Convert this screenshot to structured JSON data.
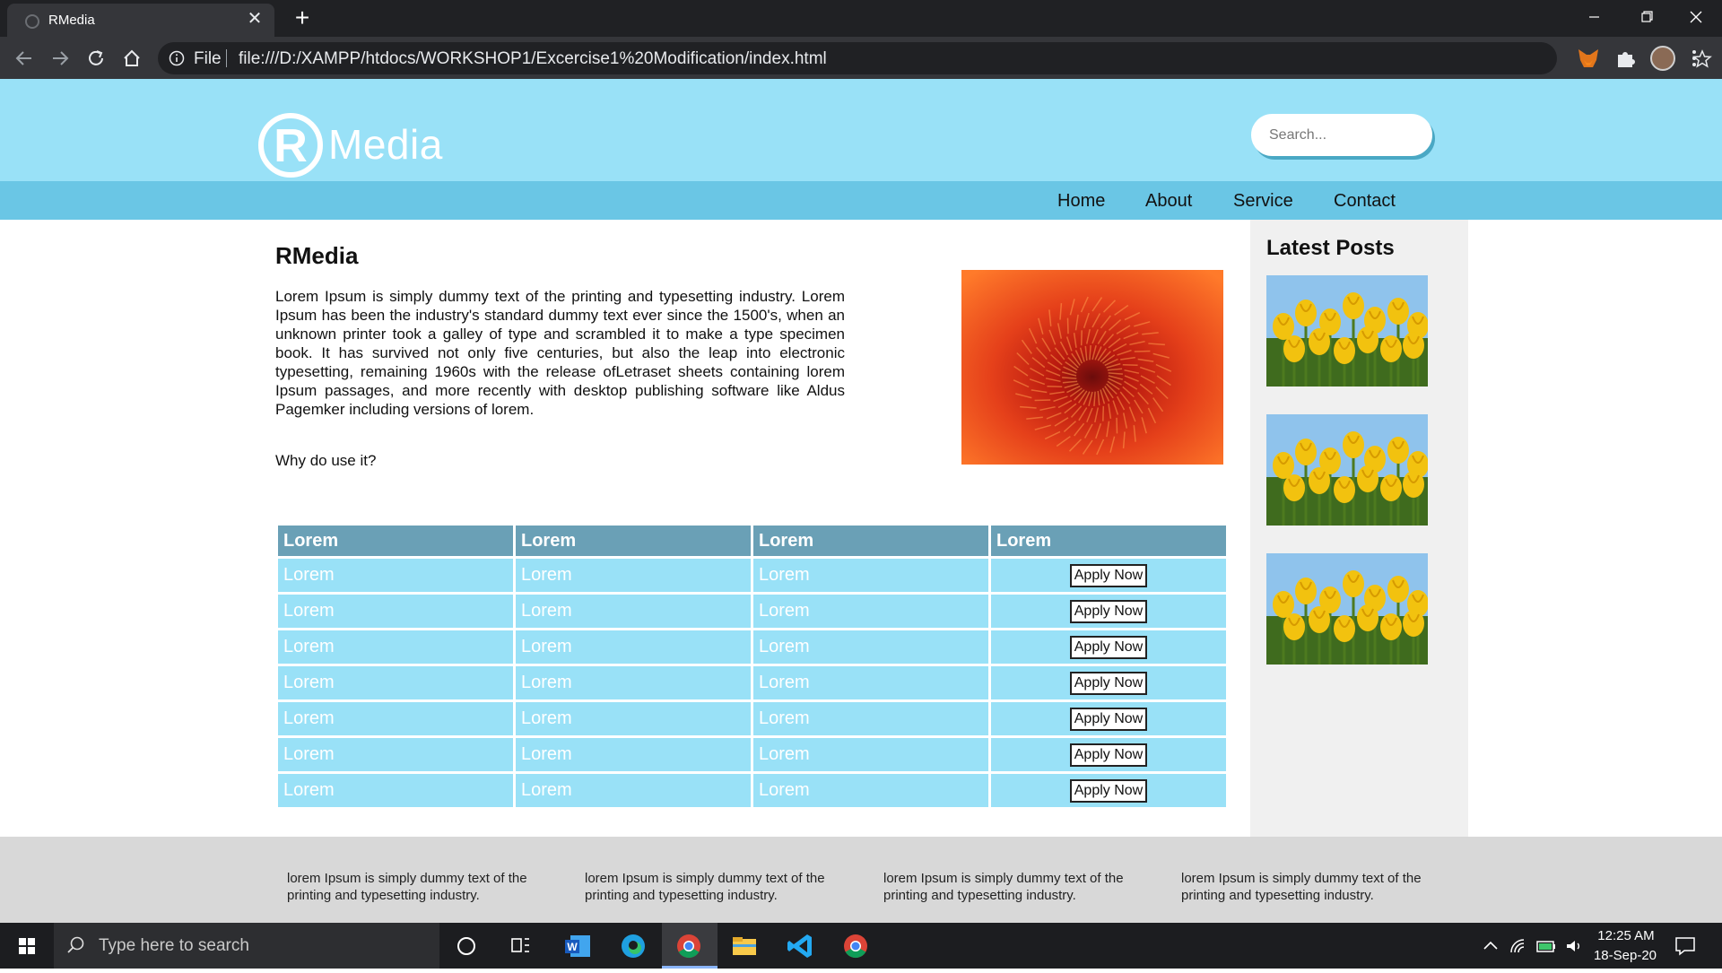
{
  "browser": {
    "tab_title": "RMedia",
    "file_label": "File",
    "url": "file:///D:/XAMPP/htdocs/WORKSHOP1/Excercise1%20Modification/index.html"
  },
  "site": {
    "logo_text": "Media",
    "search_placeholder": "Search...",
    "nav": [
      "Home",
      "About",
      "Service",
      "Contact"
    ],
    "main_title": "RMedia",
    "main_paragraph": "Lorem Ipsum is simply dummy text of the printing and typesetting industry. Lorem Ipsum has been the industry's standard dummy text ever since the 1500's, when an unknown printer took a galley of type and scrambled it to make a type specimen book. It has survived not only five centuries, but also the leap into electronic typesetting, remaining 1960s with the release ofLetraset sheets containing lorem Ipsum passages, and more recently with desktop publishing software like Aldus Pagemker including versions of lorem.",
    "why_text": "Why do use it?",
    "table": {
      "headers": [
        "Lorem",
        "Lorem",
        "Lorem",
        "Lorem"
      ],
      "cell_text": "Lorem",
      "button_label": "Apply Now",
      "row_count": 7
    },
    "sidebar_title": "Latest Posts",
    "footer_text": "lorem Ipsum is simply dummy text of the printing and typesetting industry."
  },
  "taskbar": {
    "search_placeholder": "Type here to search",
    "time": "12:25 AM",
    "date": "18-Sep-20"
  },
  "colors": {
    "header": "#99e1f7",
    "navbar": "#6ac6e5",
    "table_header": "#6aa0b6",
    "table_cell": "#99e1f7",
    "sidebar": "#f0f0f0",
    "footer": "#d8d8d8"
  }
}
